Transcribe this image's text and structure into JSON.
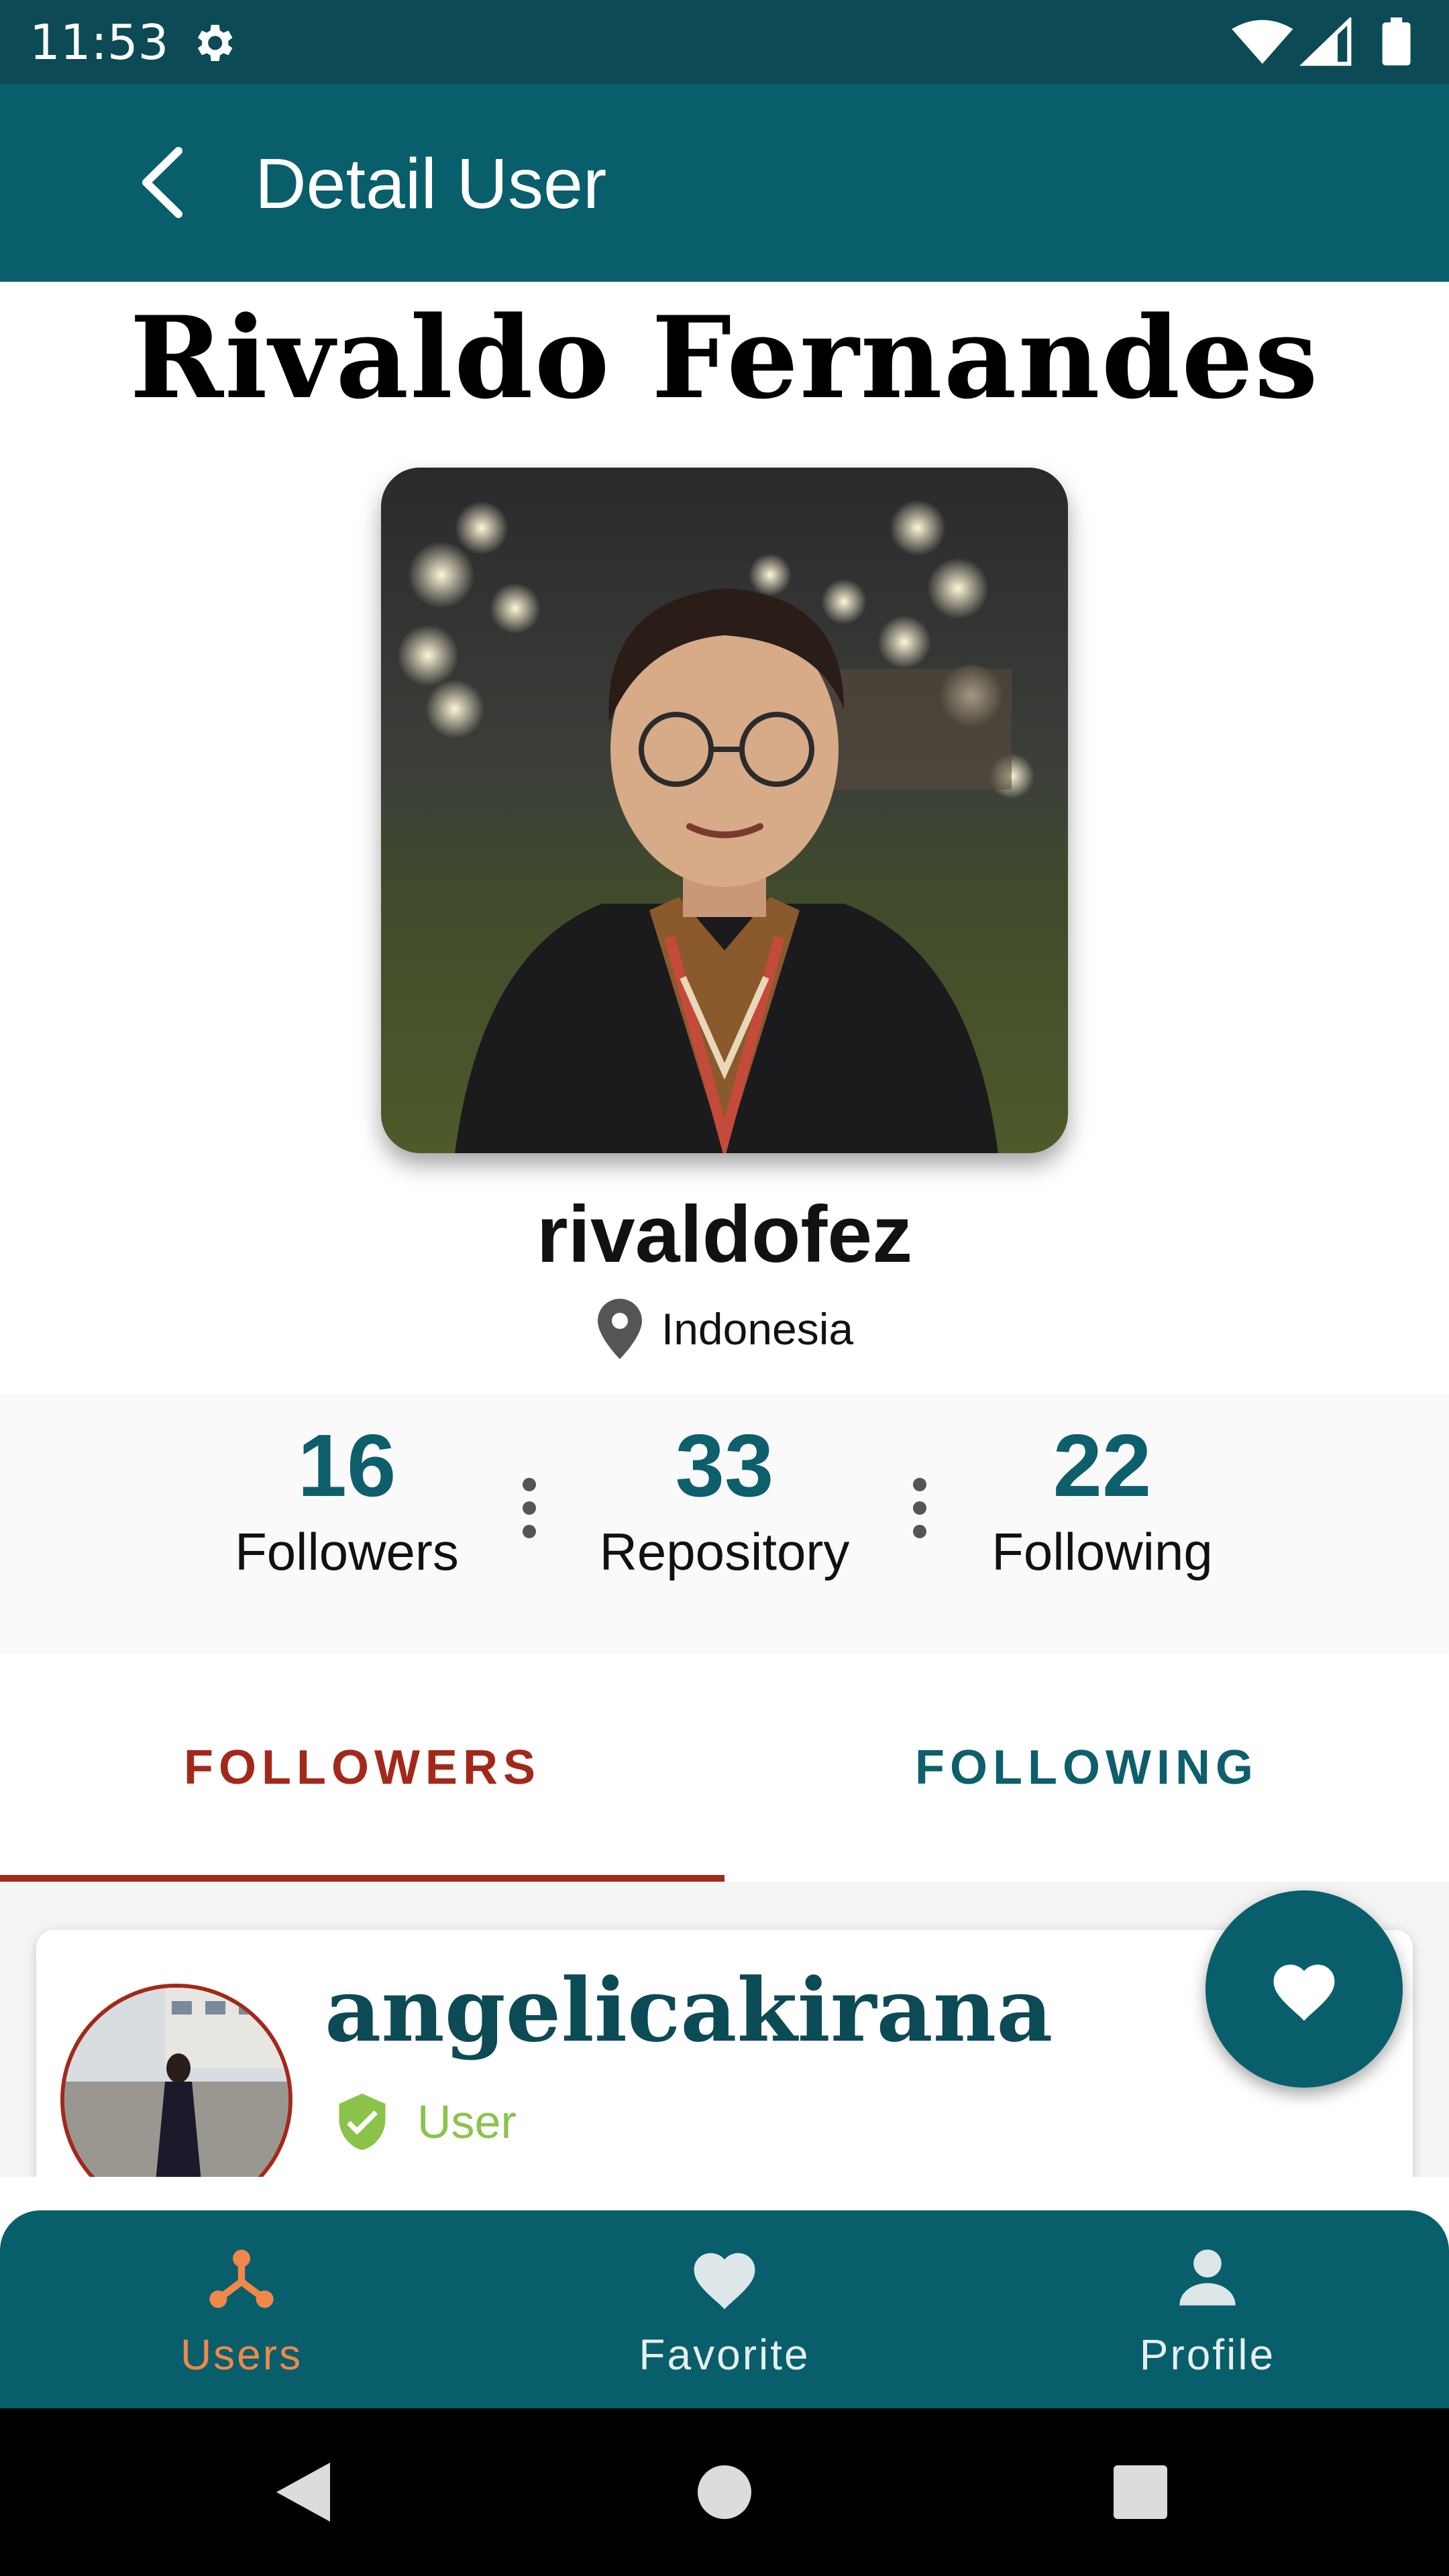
{
  "status_bar": {
    "time": "11:53",
    "icons": [
      "gear-icon",
      "wifi-icon",
      "signal-icon",
      "battery-icon"
    ]
  },
  "app_bar": {
    "title": "Detail User",
    "back_icon": "arrow-back-icon"
  },
  "profile": {
    "display_name": "Rivaldo Fernandes",
    "username": "rivaldofez",
    "location": "Indonesia",
    "avatar_description": "profile-photo"
  },
  "stats": [
    {
      "value": "16",
      "label": "Followers"
    },
    {
      "value": "33",
      "label": "Repository"
    },
    {
      "value": "22",
      "label": "Following"
    }
  ],
  "tabs": [
    {
      "label": "FOLLOWERS",
      "selected": true
    },
    {
      "label": "FOLLOWING",
      "selected": false
    }
  ],
  "followers_list": [
    {
      "login": "angelicakirana",
      "type": "User"
    }
  ],
  "bottom_nav": [
    {
      "label": "Users",
      "icon": "users-icon",
      "active": true
    },
    {
      "label": "Favorite",
      "icon": "heart-icon",
      "active": false
    },
    {
      "label": "Profile",
      "icon": "person-icon",
      "active": false
    }
  ],
  "colors": {
    "primary": "#085f6b",
    "status_bar": "#0c4a55",
    "accent_red": "#a2291a",
    "active_nav": "#f0884a",
    "verified_green": "#8bc34a"
  }
}
